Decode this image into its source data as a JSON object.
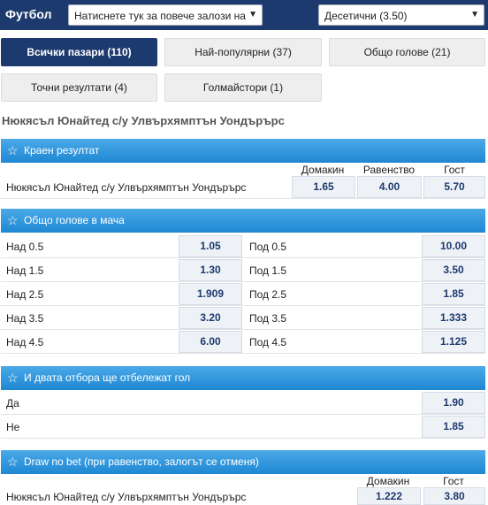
{
  "header": {
    "title": "Футбол",
    "market_select": "Натиснете тук за повече залози на",
    "odds_format": "Десетични (3.50)"
  },
  "tabs": [
    {
      "label": "Всички пазари (110)",
      "active": true
    },
    {
      "label": "Най-популярни (37)",
      "active": false
    },
    {
      "label": "Общо голове (21)",
      "active": false
    },
    {
      "label": "Точни резултати (4)",
      "active": false
    },
    {
      "label": "Голмайстори (1)",
      "active": false
    }
  ],
  "match_title": "Нюкясъл Юнайтед с/у Улвърхямптън Уондърърс",
  "final_result": {
    "title": "Краен резултат",
    "cols": [
      "Домакин",
      "Равенство",
      "Гост"
    ],
    "label": "Нюкясъл Юнайтед с/у Улвърхямптън Уондърърс",
    "odds": [
      "1.65",
      "4.00",
      "5.70"
    ]
  },
  "total_goals": {
    "title": "Общо голове в мача",
    "rows": [
      {
        "over": "Над 0.5",
        "over_odd": "1.05",
        "under": "Под 0.5",
        "under_odd": "10.00"
      },
      {
        "over": "Над 1.5",
        "over_odd": "1.30",
        "under": "Под 1.5",
        "under_odd": "3.50"
      },
      {
        "over": "Над 2.5",
        "over_odd": "1.909",
        "under": "Под 2.5",
        "under_odd": "1.85"
      },
      {
        "over": "Над 3.5",
        "over_odd": "3.20",
        "under": "Под 3.5",
        "under_odd": "1.333"
      },
      {
        "over": "Над 4.5",
        "over_odd": "6.00",
        "under": "Под 4.5",
        "under_odd": "1.125"
      }
    ]
  },
  "btts": {
    "title": "И двата отбора ще отбележат гол",
    "rows": [
      {
        "label": "Да",
        "odd": "1.90"
      },
      {
        "label": "Не",
        "odd": "1.85"
      }
    ]
  },
  "draw_no_bet": {
    "title": "Draw no bet (при равенство, залогът се отменя)",
    "cols": [
      "Домакин",
      "Гост"
    ],
    "label": "Нюкясъл Юнайтед с/у Улвърхямптън Уондърърс",
    "odds": [
      "1.222",
      "3.80"
    ]
  }
}
